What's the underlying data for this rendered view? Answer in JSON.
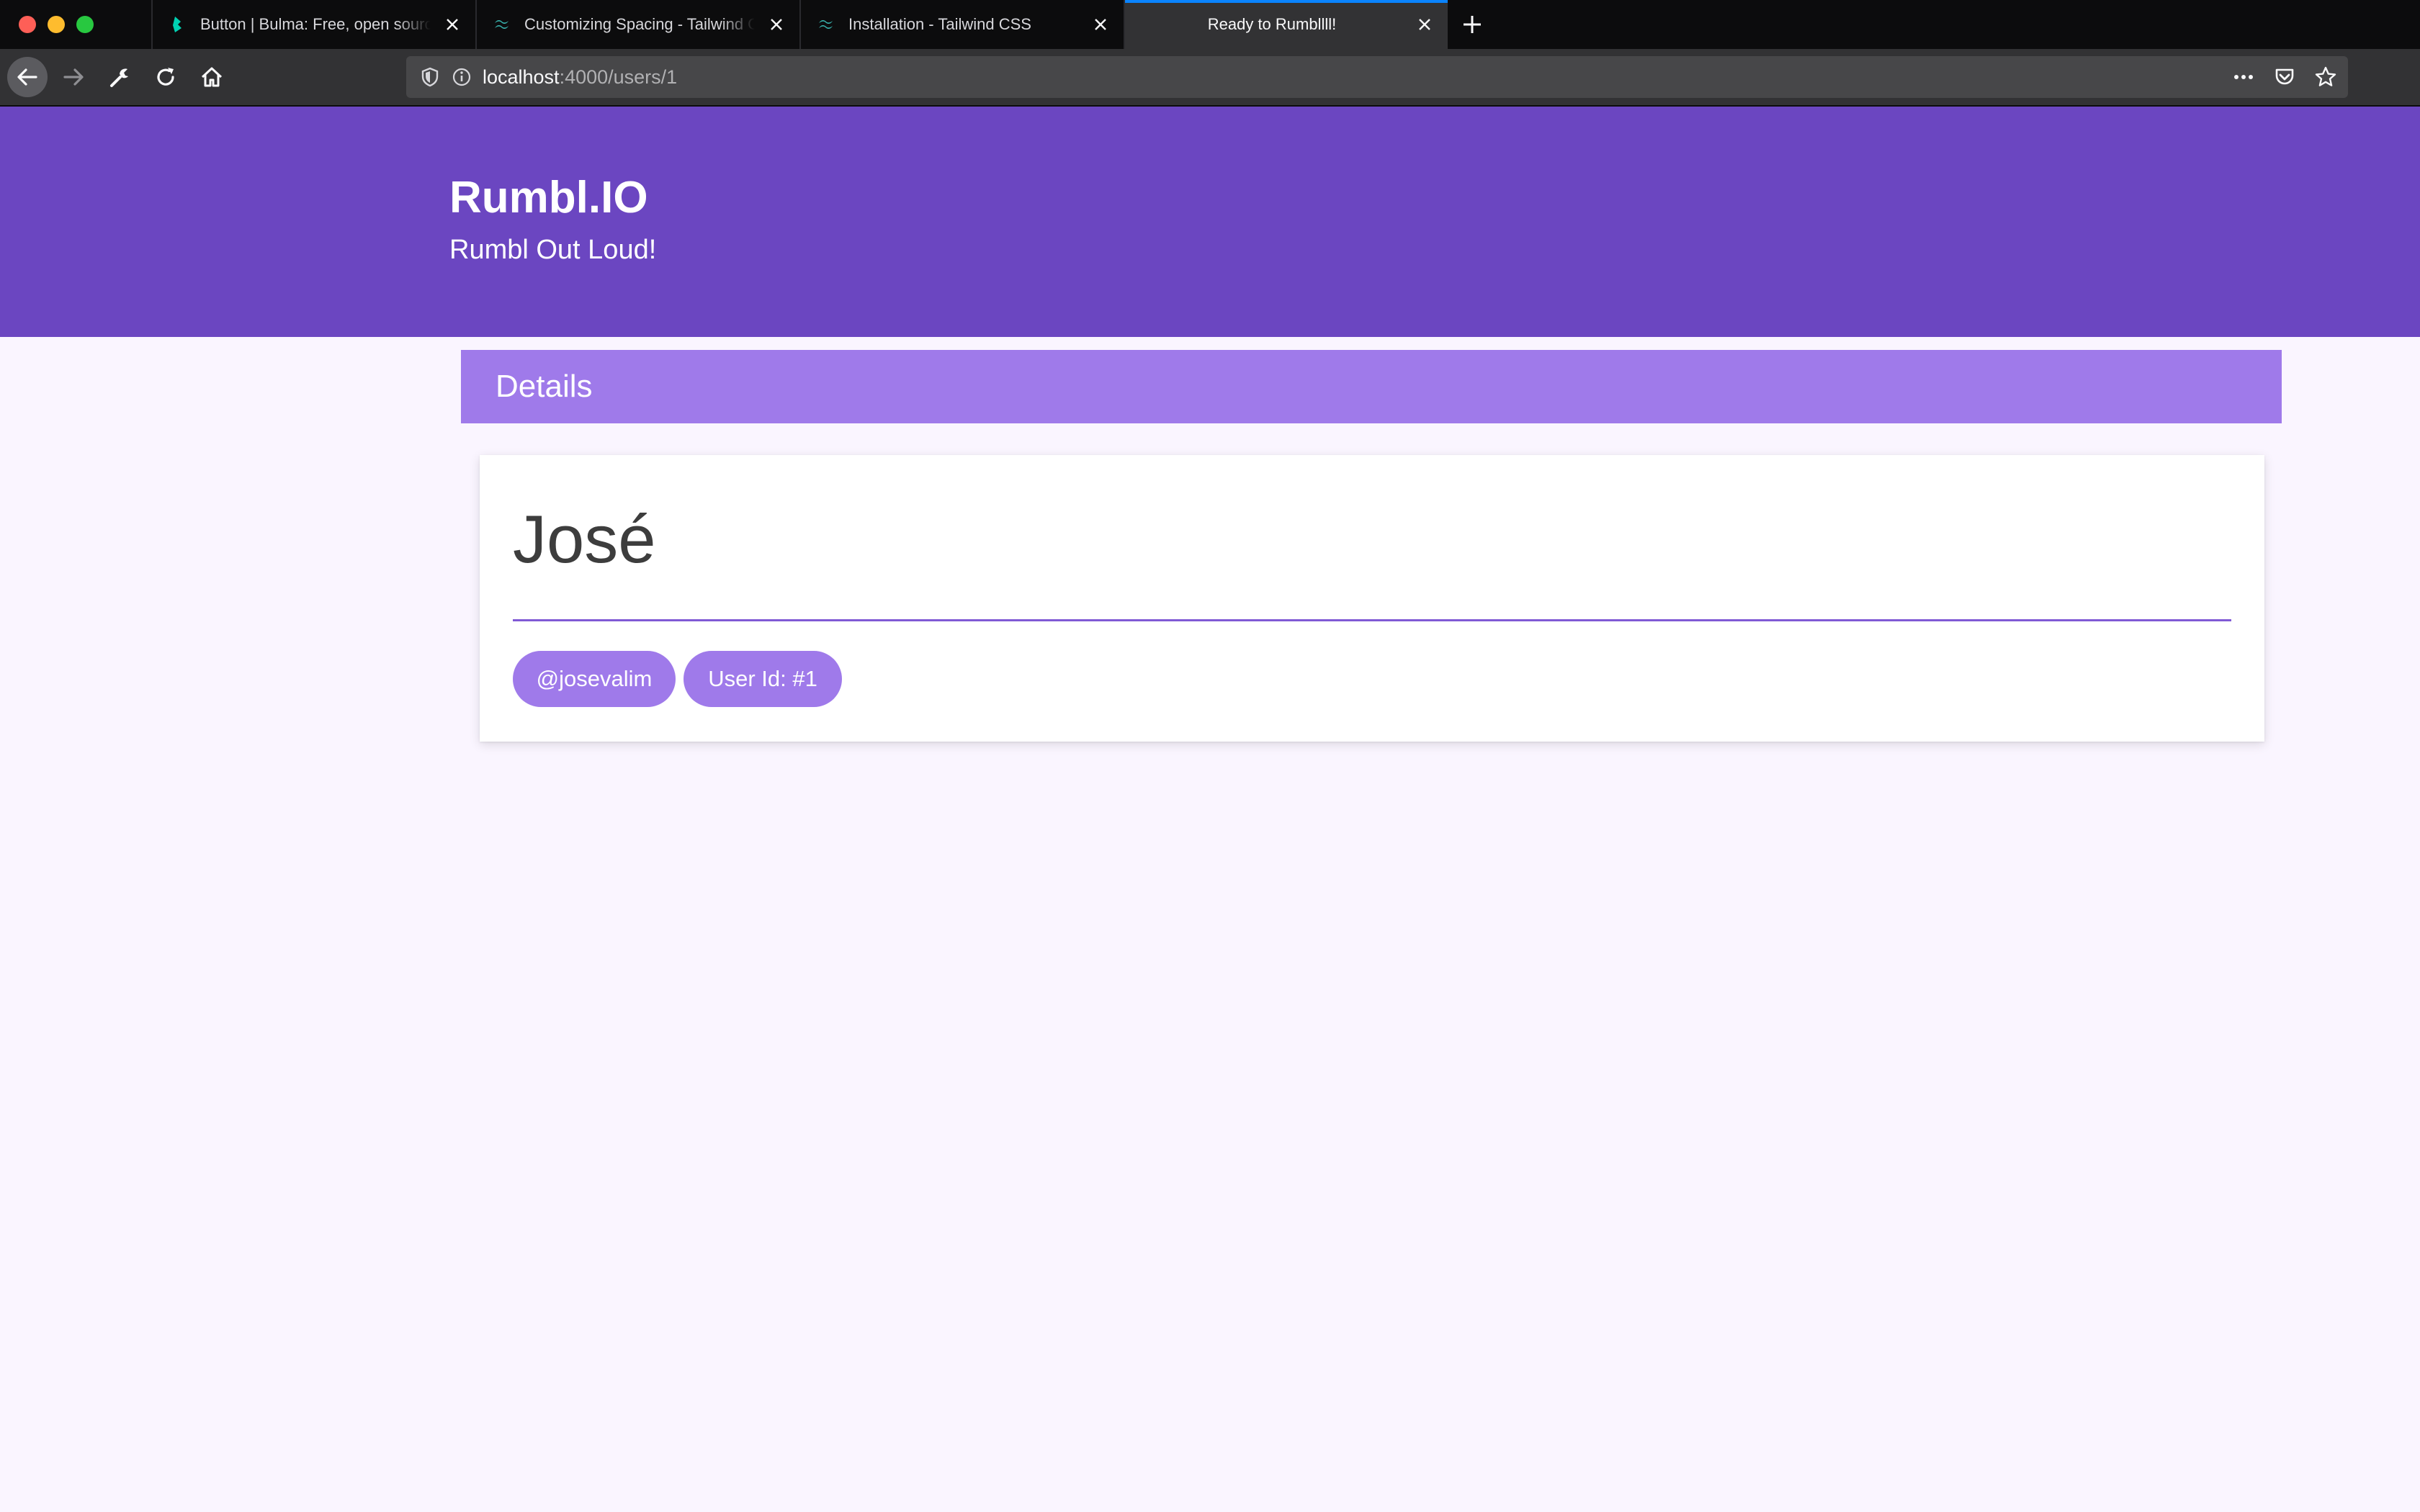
{
  "browser": {
    "tabs": [
      {
        "title": "Button | Bulma: Free, open source CSS framework",
        "favicon": "bulma-icon"
      },
      {
        "title": "Customizing Spacing - Tailwind CSS",
        "favicon": "tailwind-icon"
      },
      {
        "title": "Installation - Tailwind CSS",
        "favicon": "tailwind-icon"
      },
      {
        "title": "Ready to Rumbllll!",
        "favicon": "none",
        "active": true
      }
    ],
    "url": {
      "host": "localhost",
      "rest": ":4000/users/1"
    }
  },
  "header": {
    "brand": "Rumbl.IO",
    "tagline": "Rumbl Out Loud!"
  },
  "details": {
    "title": "Details"
  },
  "user": {
    "name": "José",
    "username": "@josevalim",
    "user_id": "User Id: #1"
  },
  "colors": {
    "hero": "#6b46c1",
    "details_bar": "#9f7aea",
    "pill": "#9f7aea",
    "divider": "#805ad5",
    "page_bg": "#faf5ff"
  }
}
